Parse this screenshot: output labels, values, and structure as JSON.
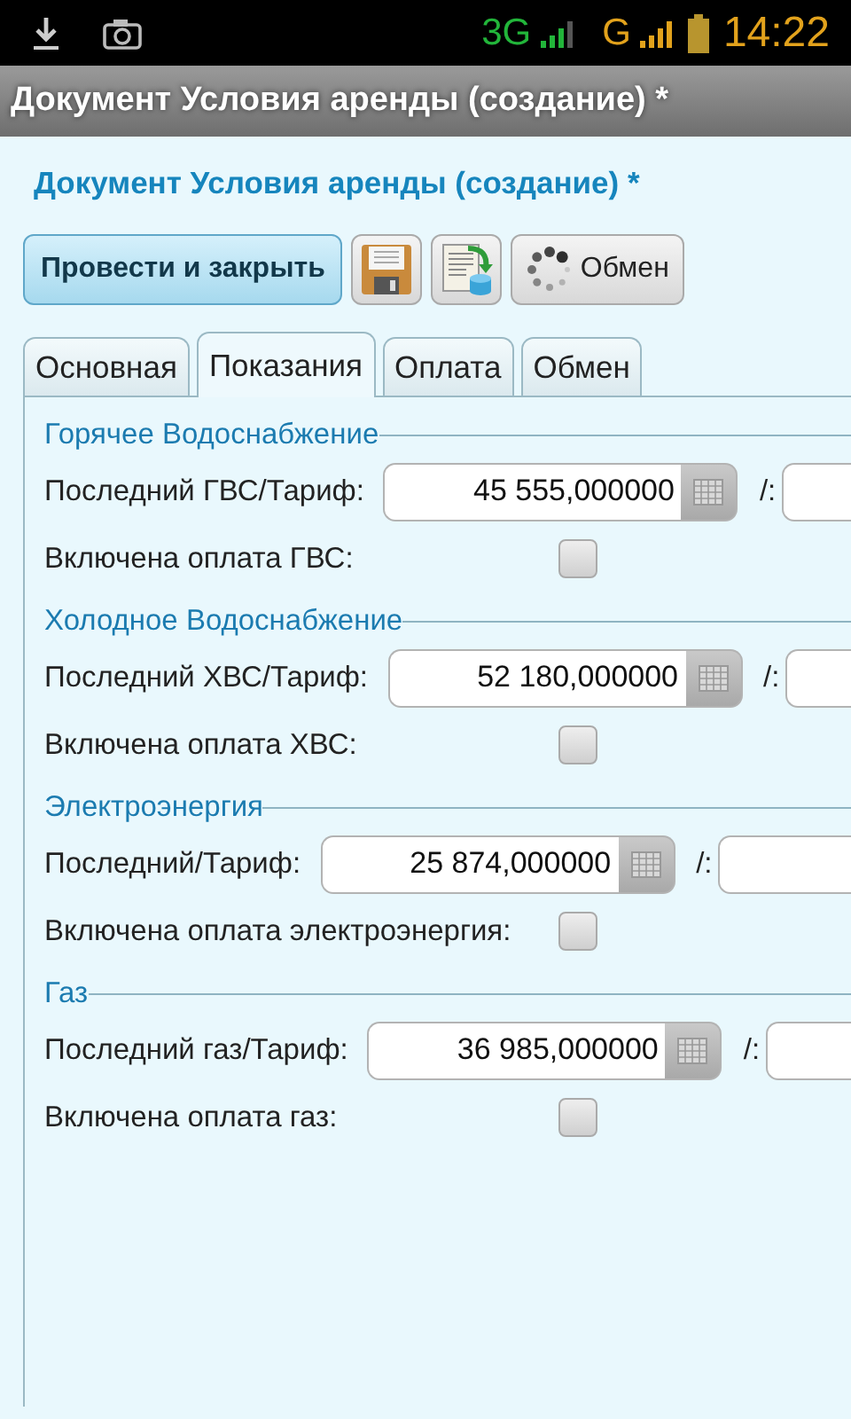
{
  "status_bar": {
    "network_1": "3G",
    "network_2": "G",
    "time": "14:22"
  },
  "window": {
    "title": "Документ Условия аренды (создание) *"
  },
  "heading": "Документ Условия аренды (создание) *",
  "toolbar": [
    {
      "kind": "primary",
      "label": "Провести и закрыть"
    },
    {
      "kind": "save"
    },
    {
      "kind": "export"
    },
    {
      "kind": "exchange",
      "label": "Обмен"
    }
  ],
  "tabs": [
    {
      "label": "Основная",
      "selected": false
    },
    {
      "label": "Показания",
      "selected": true
    },
    {
      "label": "Оплата",
      "selected": false
    },
    {
      "label": "Обмен",
      "selected": false
    }
  ],
  "sections": [
    {
      "title": "Горячее Водоснабжение",
      "fields": [
        {
          "kind": "number",
          "label": "Последний ГВС/Тариф:",
          "value": "45 555,000000",
          "separator": "/:"
        },
        {
          "kind": "checkbox",
          "label": "Включена оплата ГВС:",
          "checked": false
        }
      ]
    },
    {
      "title": "Холодное Водоснабжение",
      "fields": [
        {
          "kind": "number",
          "label": "Последний ХВС/Тариф:",
          "value": "52 180,000000",
          "separator": "/:"
        },
        {
          "kind": "checkbox",
          "label": "Включена оплата ХВС:",
          "checked": false
        }
      ]
    },
    {
      "title": "Электроэнергия",
      "fields": [
        {
          "kind": "number",
          "label": "Последний/Тариф:",
          "value": "25 874,000000",
          "separator": "/:"
        },
        {
          "kind": "checkbox",
          "label": "Включена оплата электроэнергия:",
          "checked": false
        }
      ]
    },
    {
      "title": "Газ",
      "fields": [
        {
          "kind": "number",
          "label": "Последний газ/Тариф:",
          "value": "36 985,000000",
          "separator": "/:"
        },
        {
          "kind": "checkbox",
          "label": "Включена оплата газ:",
          "checked": false
        }
      ]
    }
  ]
}
